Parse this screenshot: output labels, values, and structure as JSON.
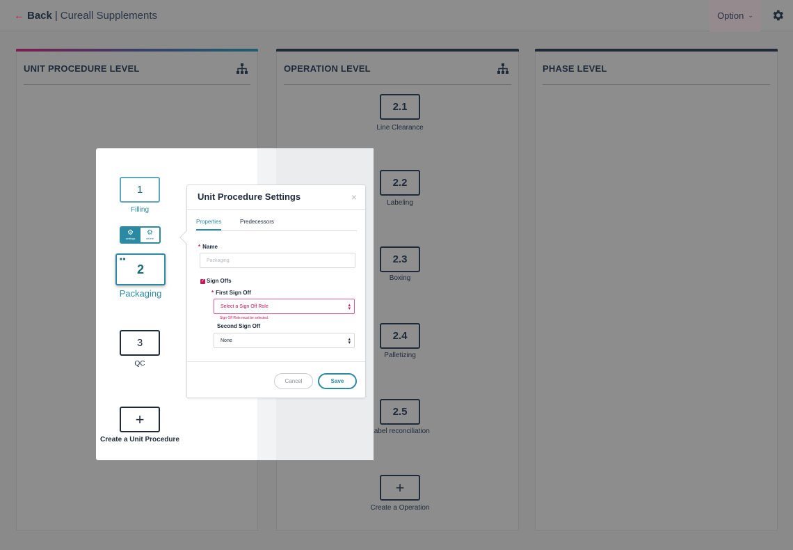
{
  "header": {
    "back_arrow": "←",
    "back_label": "Back",
    "separator": "|",
    "company": "Cureall Supplements",
    "option_label": "Option",
    "option_chevron": "chevron-down-icon",
    "settings_icon": "gear-icon"
  },
  "panels": {
    "unit_procedure": {
      "title": "UNIT PROCEDURE LEVEL",
      "icon": "hierarchy-icon"
    },
    "operation": {
      "title": "OPERATION LEVEL",
      "icon": "hierarchy-icon"
    },
    "phase": {
      "title": "PHASE LEVEL"
    }
  },
  "operations": [
    {
      "number": "2.1",
      "label": "Line Clearance"
    },
    {
      "number": "2.2",
      "label": "Labeling"
    },
    {
      "number": "2.3",
      "label": "Boxing"
    },
    {
      "number": "2.4",
      "label": "Palletizing"
    },
    {
      "number": "2.5",
      "label": "Label reconciliation"
    }
  ],
  "create_operation": {
    "icon": "+",
    "label": "Create a Operation"
  },
  "unit_procedures": [
    {
      "number": "1",
      "label": "Filling"
    },
    {
      "number": "2",
      "label": "Packaging",
      "selected": true
    },
    {
      "number": "3",
      "label": "QC"
    }
  ],
  "create_unit_procedure": {
    "icon": "+",
    "label": "Create a Unit Procedure"
  },
  "node_toolbar": {
    "settings_label": "settings",
    "delete_label": "delete"
  },
  "dialog": {
    "title": "Unit Procedure Settings",
    "close": "×",
    "tabs": [
      {
        "label": "Properties",
        "active": true
      },
      {
        "label": "Predecessors",
        "active": false
      }
    ],
    "name_label": "Name",
    "name_required": "*",
    "name_placeholder": "Packaging",
    "sign_offs_label": "Sign Offs",
    "sign_offs_checked": true,
    "first_sign_off_label": "First Sign Off",
    "first_sign_off_required": "*",
    "first_sign_off_value": "Select a Sign Off Role",
    "first_sign_off_error": "Sign Off Role must be selected.",
    "second_sign_off_label": "Second Sign Off",
    "second_sign_off_value": "None",
    "cancel_label": "Cancel",
    "save_label": "Save"
  },
  "colors": {
    "accent_teal": "#2a8aa2",
    "error_pink": "#c2185b",
    "dark_navy": "#1f2a38"
  }
}
